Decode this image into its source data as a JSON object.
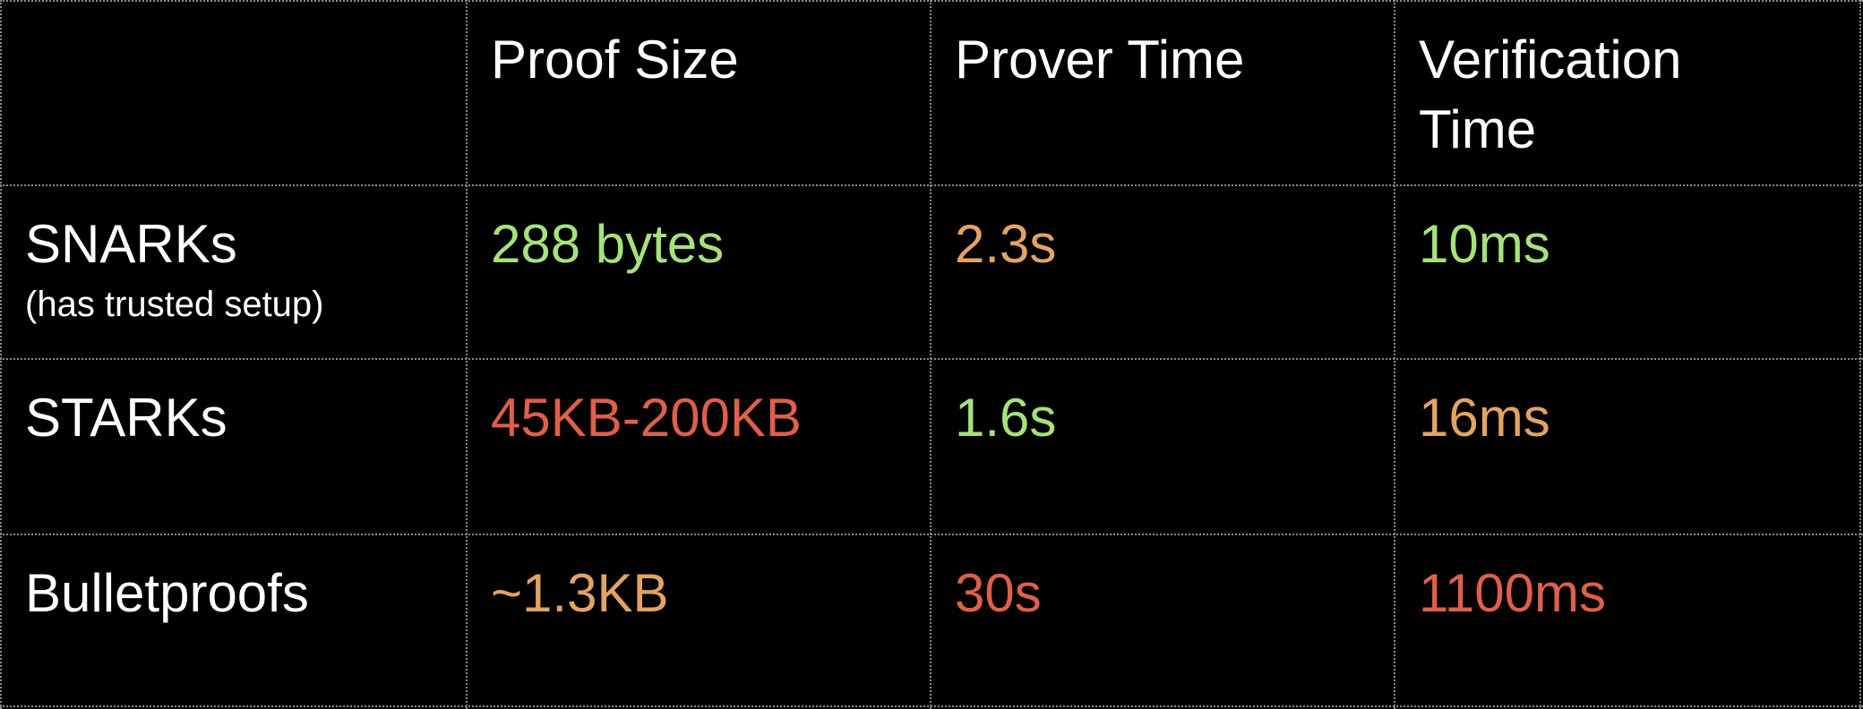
{
  "colors": {
    "good": "#a6e27a",
    "medium": "#e3a363",
    "bad": "#df5f4a",
    "text": "#ffffff",
    "background": "#000000",
    "grid": "#8a8a8a"
  },
  "table": {
    "headers": [
      "",
      "Proof Size",
      "Prover Time",
      "Verification\nTime"
    ],
    "rows": [
      {
        "label": "SNARKs",
        "note": "(has trusted setup)",
        "proof_size": {
          "value": "288 bytes",
          "rating": "good"
        },
        "prover_time": {
          "value": "2.3s",
          "rating": "medium"
        },
        "verification_time": {
          "value": "10ms",
          "rating": "good"
        }
      },
      {
        "label": "STARKs",
        "note": "",
        "proof_size": {
          "value": "45KB-200KB",
          "rating": "bad"
        },
        "prover_time": {
          "value": "1.6s",
          "rating": "good"
        },
        "verification_time": {
          "value": "16ms",
          "rating": "medium"
        }
      },
      {
        "label": "Bulletproofs",
        "note": "",
        "proof_size": {
          "value": "~1.3KB",
          "rating": "medium"
        },
        "prover_time": {
          "value": "30s",
          "rating": "bad"
        },
        "verification_time": {
          "value": "1100ms",
          "rating": "bad"
        }
      }
    ]
  }
}
